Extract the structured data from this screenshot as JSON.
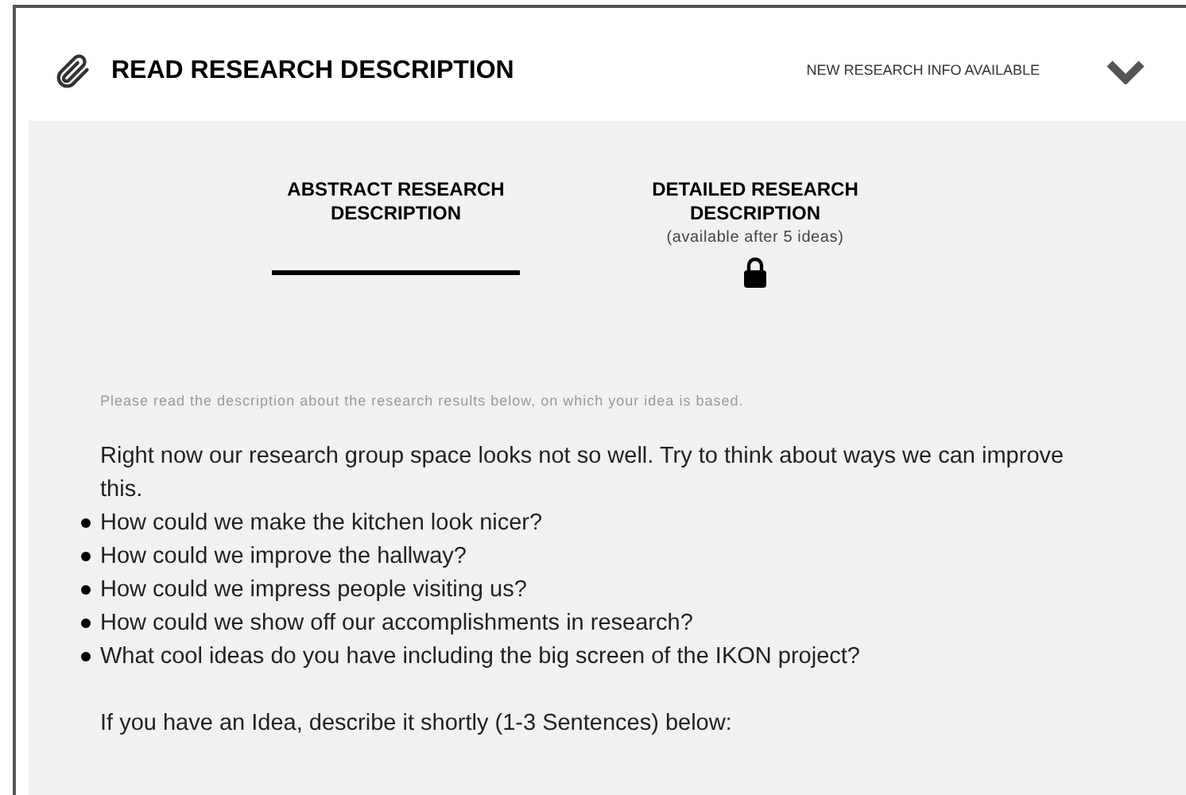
{
  "header": {
    "title": "READ RESEARCH DESCRIPTION",
    "notice": "NEW RESEARCH INFO AVAILABLE",
    "expanded": false
  },
  "tabs": [
    {
      "label": "ABSTRACT RESEARCH DESCRIPTION",
      "selected": true,
      "locked": false
    },
    {
      "label": "DETAILED RESEARCH DESCRIPTION",
      "note": "(available after 5 ideas)",
      "selected": false,
      "locked": true
    }
  ],
  "hint": "Please read the description about the research results below, on which your idea is based.",
  "intro": "Right now our research group space looks not so well. Try to think about ways we can improve this.",
  "questions": [
    "How could we make the kitchen look nicer?",
    "How could we improve the hallway?",
    "How could we impress people visiting us?",
    "How could we show off our accomplishments in research?",
    "What cool ideas do you have including the big screen of the IKON project?"
  ],
  "prompt": "If you have an Idea, describe it shortly (1-3 Sentences) below:"
}
